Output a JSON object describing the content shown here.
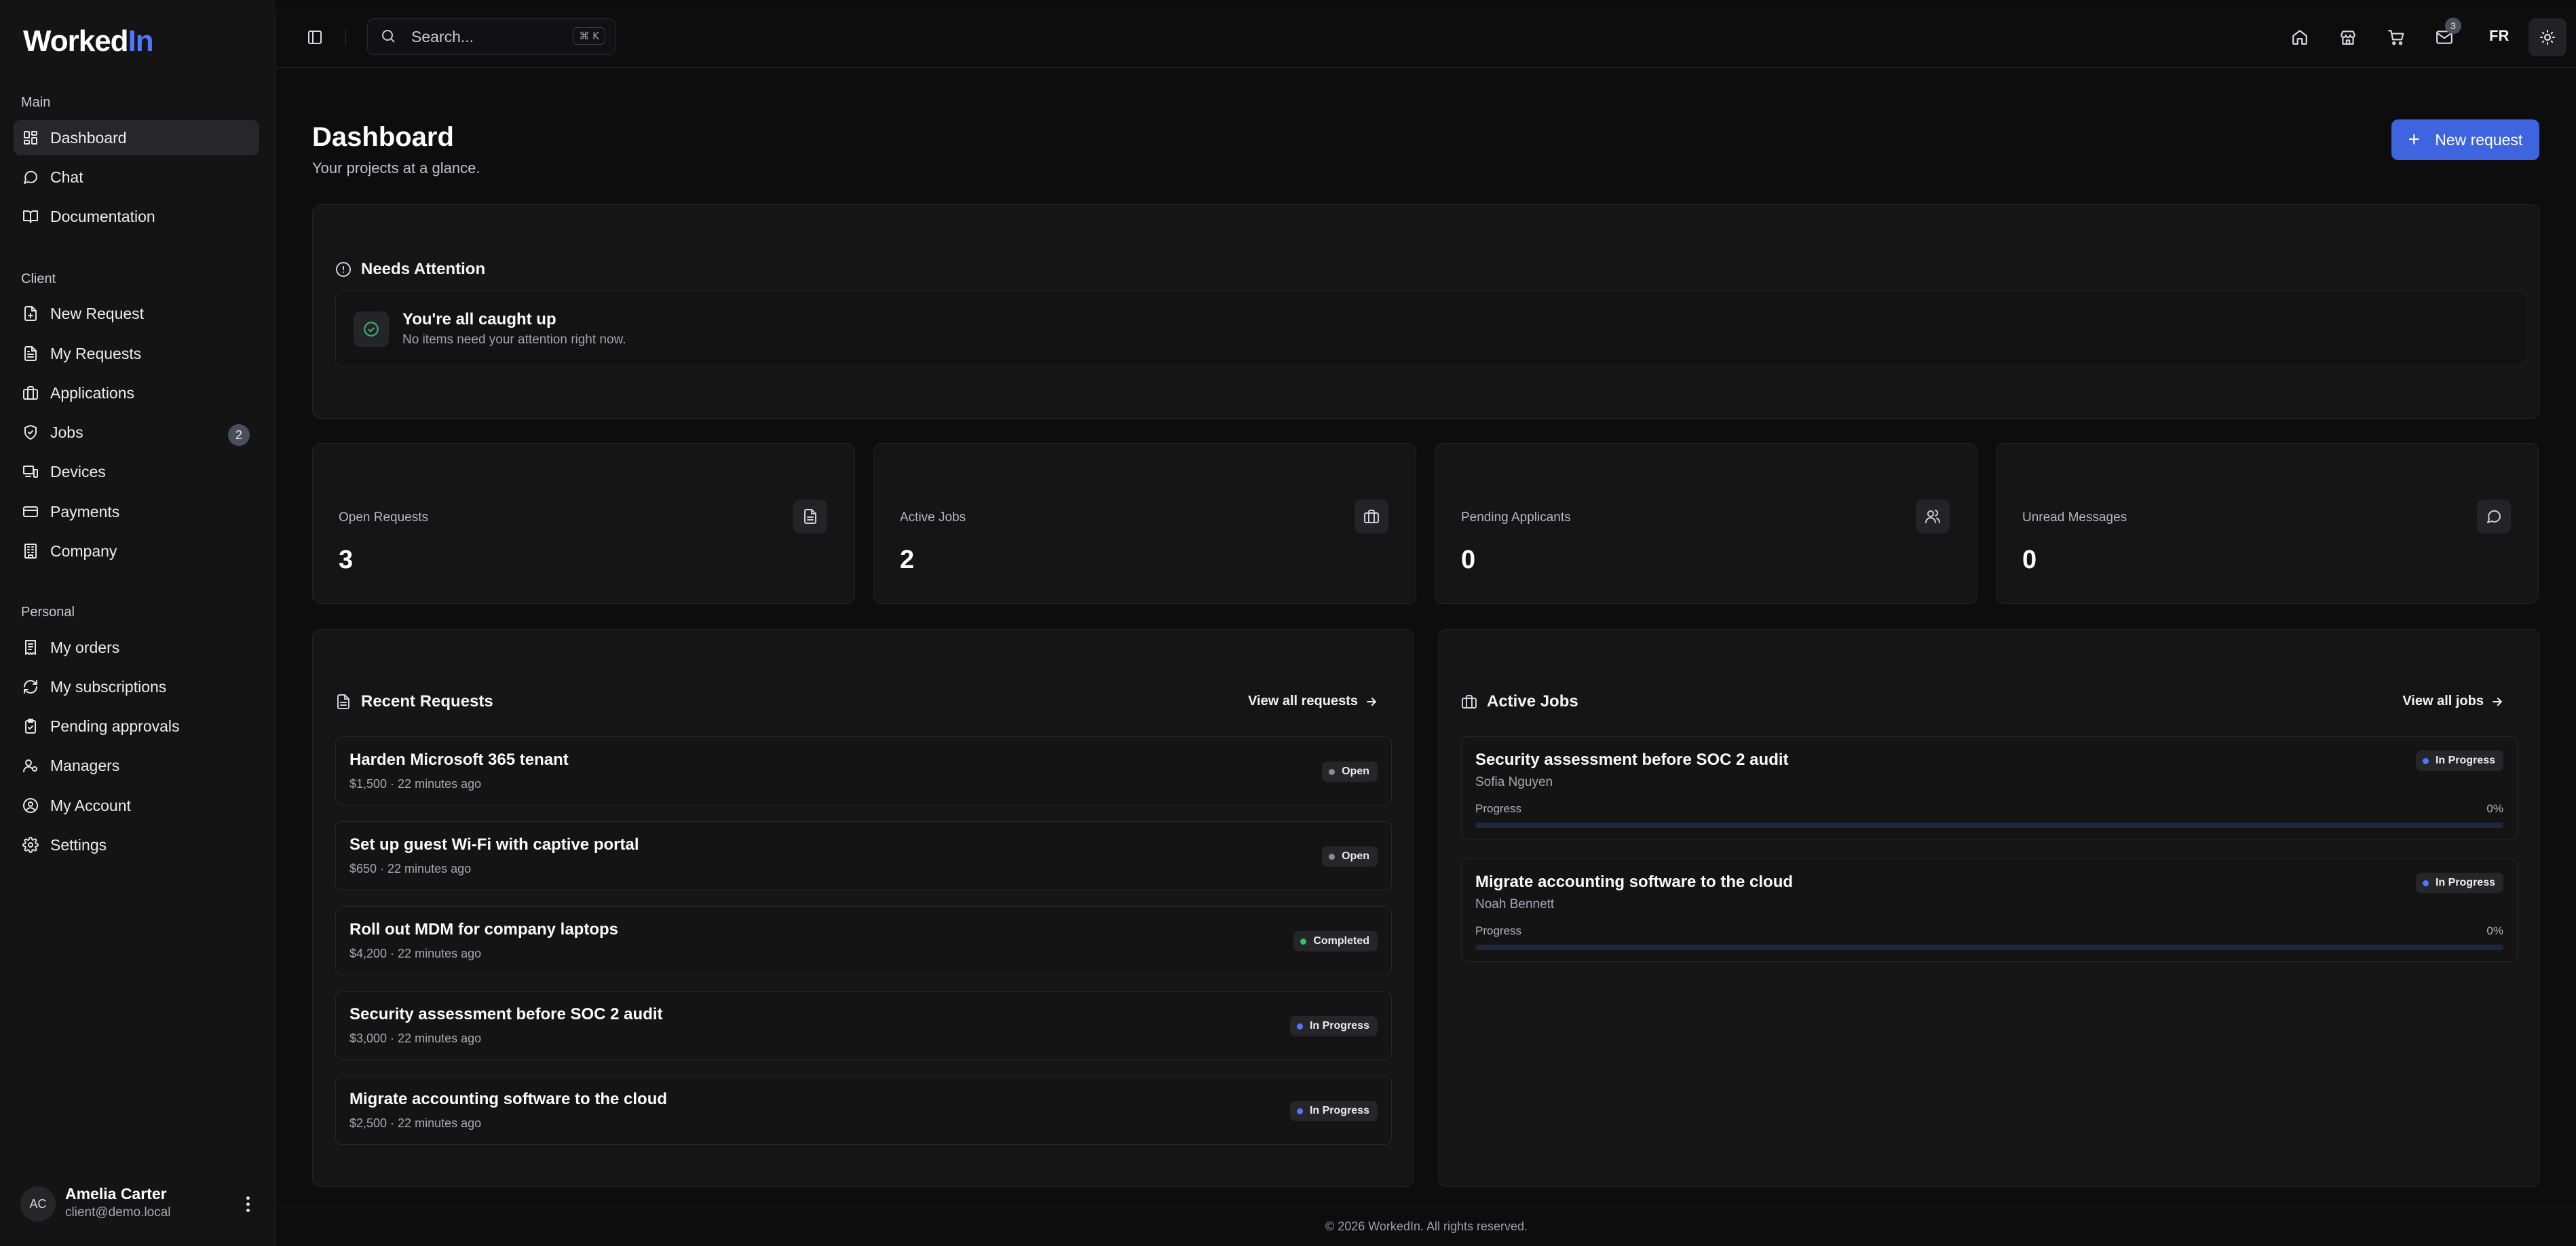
{
  "brand": {
    "name_main": "Worked",
    "name_accent": "In"
  },
  "sidebar": {
    "sections": [
      {
        "label": "Main",
        "items": [
          {
            "label": "Dashboard",
            "icon": "dashboard-icon",
            "active": true
          },
          {
            "label": "Chat",
            "icon": "chat-icon"
          },
          {
            "label": "Documentation",
            "icon": "book-icon"
          }
        ]
      },
      {
        "label": "Client",
        "items": [
          {
            "label": "New Request",
            "icon": "file-plus-icon"
          },
          {
            "label": "My Requests",
            "icon": "file-text-icon"
          },
          {
            "label": "Applications",
            "icon": "briefcase-icon"
          },
          {
            "label": "Jobs",
            "icon": "shield-check-icon",
            "badge": "2"
          },
          {
            "label": "Devices",
            "icon": "devices-icon"
          },
          {
            "label": "Payments",
            "icon": "credit-card-icon"
          },
          {
            "label": "Company",
            "icon": "building-icon"
          }
        ]
      },
      {
        "label": "Personal",
        "items": [
          {
            "label": "My orders",
            "icon": "receipt-icon"
          },
          {
            "label": "My subscriptions",
            "icon": "refresh-icon"
          },
          {
            "label": "Pending approvals",
            "icon": "clipboard-check-icon"
          },
          {
            "label": "Managers",
            "icon": "users-cog-icon"
          },
          {
            "label": "My Account",
            "icon": "user-circle-icon"
          },
          {
            "label": "Settings",
            "icon": "gear-icon"
          }
        ]
      }
    ],
    "user": {
      "initials": "AC",
      "name": "Amelia Carter",
      "email": "client@demo.local"
    }
  },
  "topbar": {
    "search_placeholder": "Search...",
    "search_shortcut": "⌘ K",
    "mail_badge": "3",
    "language": "FR"
  },
  "page": {
    "title": "Dashboard",
    "subtitle": "Your projects at a glance.",
    "new_request_label": "New request"
  },
  "attention": {
    "title": "Needs Attention",
    "status_title": "You're all caught up",
    "status_text": "No items need your attention right now."
  },
  "stats": [
    {
      "label": "Open Requests",
      "value": "3",
      "icon": "file-text-icon"
    },
    {
      "label": "Active Jobs",
      "value": "2",
      "icon": "briefcase-icon"
    },
    {
      "label": "Pending Applicants",
      "value": "0",
      "icon": "users-icon"
    },
    {
      "label": "Unread Messages",
      "value": "0",
      "icon": "chat-icon"
    }
  ],
  "recent_requests": {
    "title": "Recent Requests",
    "view_all": "View all requests",
    "items": [
      {
        "title": "Harden Microsoft 365 tenant",
        "meta": "$1,500 · 22 minutes ago",
        "status": "Open",
        "status_color": "#8a8a92"
      },
      {
        "title": "Set up guest Wi-Fi with captive portal",
        "meta": "$650 · 22 minutes ago",
        "status": "Open",
        "status_color": "#8a8a92"
      },
      {
        "title": "Roll out MDM for company laptops",
        "meta": "$4,200 · 22 minutes ago",
        "status": "Completed",
        "status_color": "#35c26b"
      },
      {
        "title": "Security assessment before SOC 2 audit",
        "meta": "$3,000 · 22 minutes ago",
        "status": "In Progress",
        "status_color": "#4f76ff"
      },
      {
        "title": "Migrate accounting software to the cloud",
        "meta": "$2,500 · 22 minutes ago",
        "status": "In Progress",
        "status_color": "#4f76ff"
      }
    ]
  },
  "active_jobs": {
    "title": "Active Jobs",
    "view_all": "View all jobs",
    "items": [
      {
        "title": "Security assessment before SOC 2 audit",
        "assignee": "Sofia Nguyen",
        "status": "In Progress",
        "status_color": "#4f76ff",
        "progress_label": "Progress",
        "progress_text": "0%",
        "progress": 0
      },
      {
        "title": "Migrate accounting software to the cloud",
        "assignee": "Noah Bennett",
        "status": "In Progress",
        "status_color": "#4f76ff",
        "progress_label": "Progress",
        "progress_text": "0%",
        "progress": 0
      }
    ]
  },
  "footer": {
    "text": "© 2026 WorkedIn. All rights reserved."
  },
  "colors": {
    "accent": "#3e64e0",
    "background": "#0d0d0e",
    "panel": "#151516"
  }
}
